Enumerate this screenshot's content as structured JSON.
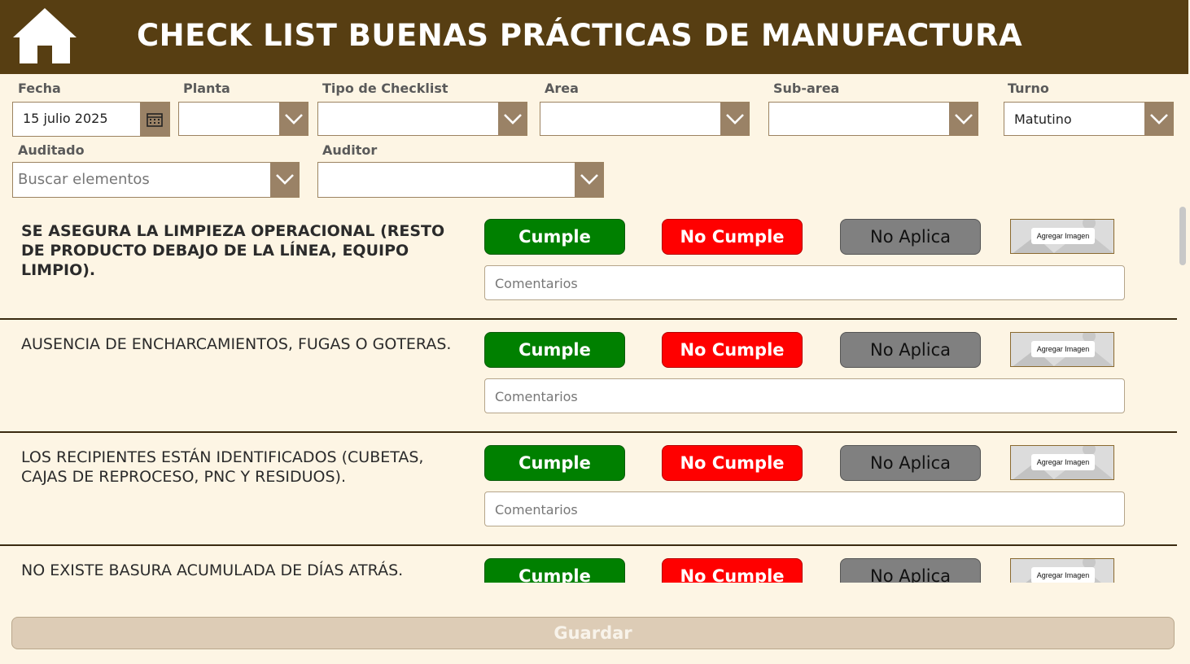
{
  "header": {
    "title": "CHECK LIST BUENAS PRÁCTICAS DE MANUFACTURA",
    "home_icon": "home-icon"
  },
  "form": {
    "fecha": {
      "label": "Fecha",
      "value": "15 julio 2025"
    },
    "planta": {
      "label": "Planta",
      "value": ""
    },
    "tipo": {
      "label": "Tipo de Checklist",
      "value": ""
    },
    "area": {
      "label": "Area",
      "value": ""
    },
    "subarea": {
      "label": "Sub-area",
      "value": ""
    },
    "turno": {
      "label": "Turno",
      "value": "Matutino"
    },
    "auditado": {
      "label": "Auditado",
      "placeholder": "Buscar elementos"
    },
    "auditor": {
      "label": "Auditor",
      "value": ""
    }
  },
  "buttons": {
    "cumple": "Cumple",
    "no_cumple": "No Cumple",
    "no_aplica": "No Aplica",
    "agregar_imagen": "Agregar Imagen",
    "comentarios": "Comentarios"
  },
  "items": [
    {
      "question": "SE ASEGURA LA LIMPIEZA OPERACIONAL (RESTO DE PRODUCTO DEBAJO DE LA LÍNEA, EQUIPO LIMPIO).",
      "bold": true
    },
    {
      "question": "AUSENCIA DE ENCHARCAMIENTOS, FUGAS O GOTERAS.",
      "bold": false
    },
    {
      "question": "LOS RECIPIENTES ESTÁN IDENTIFICADOS (CUBETAS, CAJAS DE REPROCESO, PNC Y RESIDUOS).",
      "bold": false
    },
    {
      "question": "NO EXISTE BASURA ACUMULADA DE DÍAS ATRÁS.",
      "bold": false
    }
  ],
  "footer": {
    "save_label": "Guardar"
  },
  "colors": {
    "header": "#573e12",
    "background": "#fdf5e4",
    "cumple": "#008000",
    "no_cumple": "#ff0000",
    "no_aplica": "#808080"
  }
}
